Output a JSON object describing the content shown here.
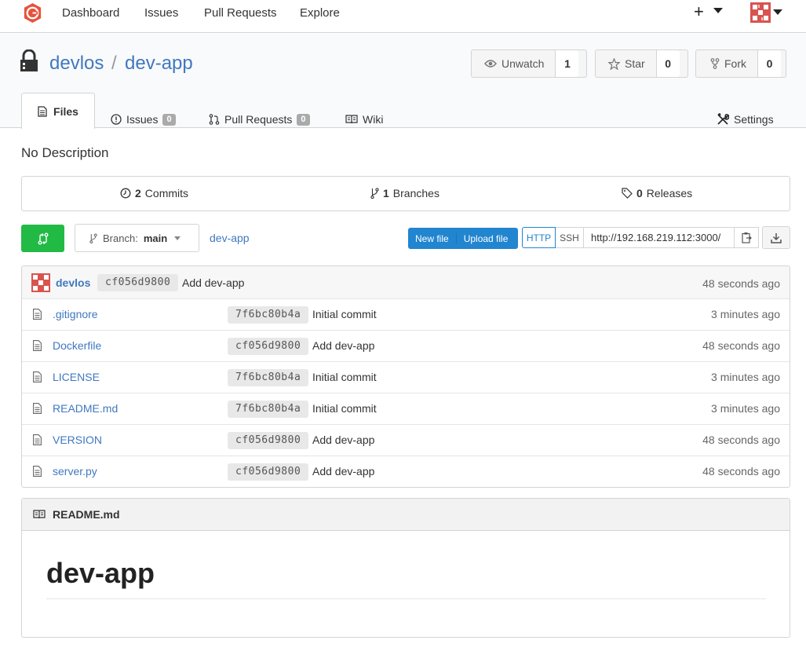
{
  "nav": {
    "items": [
      "Dashboard",
      "Issues",
      "Pull Requests",
      "Explore"
    ],
    "plus": "+"
  },
  "repo": {
    "owner": "devlos",
    "separator": "/",
    "name": "dev-app",
    "description": "No Description"
  },
  "actions": {
    "watch": {
      "label": "Unwatch",
      "count": "1"
    },
    "star": {
      "label": "Star",
      "count": "0"
    },
    "fork": {
      "label": "Fork",
      "count": "0"
    }
  },
  "tabs": {
    "files": "Files",
    "issues": {
      "label": "Issues",
      "count": "0"
    },
    "pulls": {
      "label": "Pull Requests",
      "count": "0"
    },
    "wiki": "Wiki",
    "settings": "Settings"
  },
  "stats": {
    "commits": {
      "count": "2",
      "label": "Commits"
    },
    "branches": {
      "count": "1",
      "label": "Branches"
    },
    "releases": {
      "count": "0",
      "label": "Releases"
    }
  },
  "toolbar": {
    "branch_prefix": "Branch:",
    "branch": "main",
    "breadcrumb": "dev-app",
    "new_file": "New file",
    "upload_file": "Upload file",
    "http": "HTTP",
    "ssh": "SSH",
    "clone_url": "http://192.168.219.112:3000/"
  },
  "latest_commit": {
    "author": "devlos",
    "sha": "cf056d9800",
    "message": "Add dev-app",
    "age": "48 seconds ago"
  },
  "files": [
    {
      "name": ".gitignore",
      "sha": "7f6bc80b4a",
      "message": "Initial commit",
      "age": "3 minutes ago"
    },
    {
      "name": "Dockerfile",
      "sha": "cf056d9800",
      "message": "Add dev-app",
      "age": "48 seconds ago"
    },
    {
      "name": "LICENSE",
      "sha": "7f6bc80b4a",
      "message": "Initial commit",
      "age": "3 minutes ago"
    },
    {
      "name": "README.md",
      "sha": "7f6bc80b4a",
      "message": "Initial commit",
      "age": "3 minutes ago"
    },
    {
      "name": "VERSION",
      "sha": "cf056d9800",
      "message": "Add dev-app",
      "age": "48 seconds ago"
    },
    {
      "name": "server.py",
      "sha": "cf056d9800",
      "message": "Add dev-app",
      "age": "48 seconds ago"
    }
  ],
  "readme": {
    "filename": "README.md",
    "heading": "dev-app"
  },
  "colors": {
    "link": "#4078c0",
    "green": "#21ba45",
    "blue": "#2185d0",
    "brand": "#e6533c"
  },
  "icons": {
    "logo": "gitea-logo-icon",
    "lock": "lock-icon",
    "eye": "eye-icon",
    "star": "star-icon",
    "fork": "fork-icon",
    "file": "file-icon",
    "book": "book-icon"
  }
}
